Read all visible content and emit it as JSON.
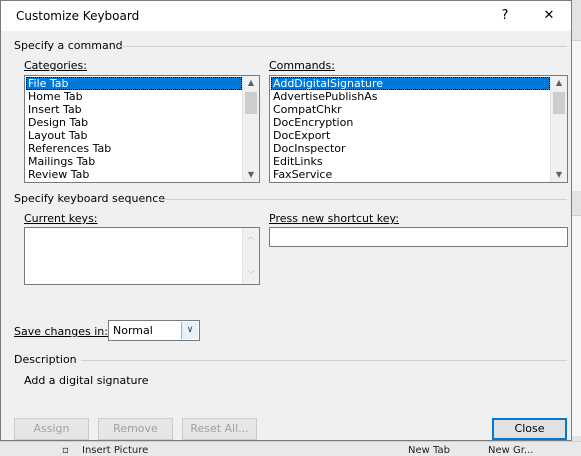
{
  "window": {
    "title": "Customize Keyboard",
    "help_glyph": "?",
    "close_glyph": "✕"
  },
  "specify_command": {
    "heading": "Specify a command",
    "categories_label": "Categories:",
    "categories": [
      "File Tab",
      "Home Tab",
      "Insert Tab",
      "Design Tab",
      "Layout Tab",
      "References Tab",
      "Mailings Tab",
      "Review Tab"
    ],
    "categories_selected": "File Tab",
    "commands_label": "Commands:",
    "commands": [
      "AddDigitalSignature",
      "AdvertisePublishAs",
      "CompatChkr",
      "DocEncryption",
      "DocExport",
      "DocInspector",
      "EditLinks",
      "FaxService"
    ],
    "commands_selected": "AddDigitalSignature"
  },
  "keyboard_sequence": {
    "heading": "Specify keyboard sequence",
    "current_keys_label": "Current keys:",
    "press_new_label": "Press new shortcut key:",
    "press_new_value": ""
  },
  "save_changes": {
    "label": "Save changes in:",
    "value": "Normal"
  },
  "description": {
    "heading": "Description",
    "text": "Add a digital signature"
  },
  "buttons": {
    "assign": "Assign",
    "remove": "Remove",
    "reset_all": "Reset All...",
    "close": "Close"
  },
  "background": {
    "bottom_texts": [
      "Insert Picture",
      "New Tab",
      "New Gr..."
    ]
  },
  "colors": {
    "selection": "#0078d7",
    "dialog_bg": "#f0f0f0"
  },
  "icons": {
    "scroll_up": "scroll-up-arrow-icon",
    "scroll_down": "scroll-down-arrow-icon",
    "dropdown": "chevron-down-icon"
  }
}
